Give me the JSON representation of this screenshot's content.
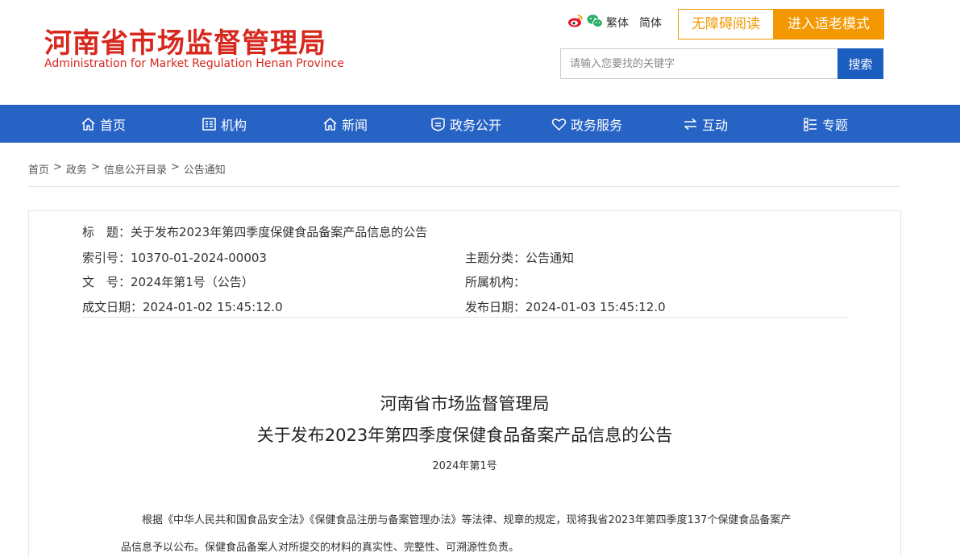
{
  "header": {
    "logo_cn": "河南省市场监督管理局",
    "logo_en": "Administration for Market Regulation Henan Province",
    "lang_traditional": "繁体",
    "lang_simplified": "简体",
    "accessibility_btn": "无障碍阅读",
    "elder_mode_btn": "进入适老模式",
    "search_placeholder": "请输入您要找的关键字",
    "search_btn": "搜索"
  },
  "nav": {
    "items": [
      {
        "label": "首页",
        "icon": "home-icon"
      },
      {
        "label": "机构",
        "icon": "org-icon"
      },
      {
        "label": "新闻",
        "icon": "news-icon"
      },
      {
        "label": "政务公开",
        "icon": "gov-open-icon"
      },
      {
        "label": "政务服务",
        "icon": "heart-icon"
      },
      {
        "label": "互动",
        "icon": "interaction-icon"
      },
      {
        "label": "专题",
        "icon": "topic-icon"
      }
    ]
  },
  "breadcrumb": [
    "首页",
    "政务",
    "信息公开目录",
    "公告通知"
  ],
  "breadcrumb_sep": ">",
  "meta": {
    "title_label": "标　题：",
    "title_value": "关于发布2023年第四季度保健食品备案产品信息的公告",
    "index_label": "索引号：",
    "index_value": "10370-01-2024-00003",
    "category_label": "主题分类：",
    "category_value": "公告通知",
    "docno_label": "文　号：",
    "docno_value": "2024年第1号（公告）",
    "org_label": "所属机构：",
    "org_value": "",
    "created_label": "成文日期：",
    "created_value": "2024-01-02 15:45:12.0",
    "published_label": "发布日期：",
    "published_value": "2024-01-03 15:45:12.0"
  },
  "document": {
    "title_line1": "河南省市场监督管理局",
    "title_line2": "关于发布2023年第四季度保健食品备案产品信息的公告",
    "number": "2024年第1号",
    "para1_line1": "根据《中华人民共和国食品安全法》《保健食品注册与备案管理办法》等法律、规章的规定，现将我省2023年第四季度137个保健食品备案产",
    "para1_line2": "品信息予以公布。保健食品备案人对所提交的材料的真实性、完整性、可溯源性负责。"
  },
  "colors": {
    "brand_red": "#d7281e",
    "accent_orange": "#f39800",
    "nav_blue": "#2763c5",
    "search_blue": "#1c5ebf"
  }
}
